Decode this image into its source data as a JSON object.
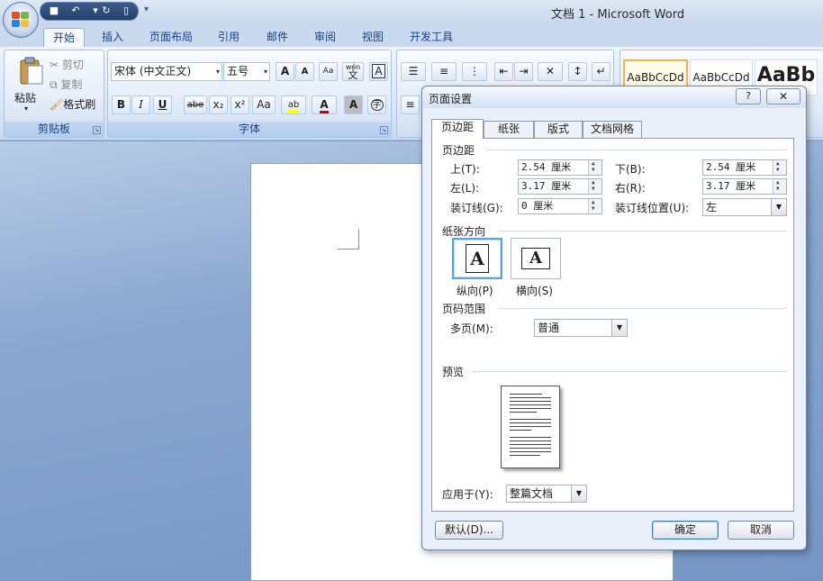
{
  "window": {
    "title": "文档 1 - Microsoft Word"
  },
  "ribbon_tabs": [
    "开始",
    "插入",
    "页面布局",
    "引用",
    "邮件",
    "审阅",
    "视图",
    "开发工具"
  ],
  "clipboard": {
    "paste": "粘贴",
    "cut": "剪切",
    "copy": "复制",
    "format_painter": "格式刷",
    "group_label": "剪贴板"
  },
  "font": {
    "name": "宋体 (中文正文)",
    "size": "五号",
    "group_label": "字体",
    "grow": "A",
    "shrink": "A",
    "bold": "B",
    "italic": "I",
    "underline": "U",
    "strike": "abe",
    "subscript": "x₂",
    "superscript": "x²",
    "case": "Aa",
    "highlight": "ab",
    "color": "A",
    "char_shading": "A",
    "enclose": "字",
    "phonetic": "wén",
    "phonetic_char": "文",
    "border": "A"
  },
  "styles": [
    {
      "label": "AaBbCcDd"
    },
    {
      "label": "AaBbCcDd"
    },
    {
      "label": "AaBb"
    }
  ],
  "dialog": {
    "title": "页面设置",
    "help": "?",
    "close": "✕",
    "tabs": [
      "页边距",
      "纸张",
      "版式",
      "文档网格"
    ],
    "margins_section": "页边距",
    "top_label": "上(T):",
    "top_value": "2.54 厘米",
    "bottom_label": "下(B):",
    "bottom_value": "2.54 厘米",
    "left_label": "左(L):",
    "left_value": "3.17 厘米",
    "right_label": "右(R):",
    "right_value": "3.17 厘米",
    "gutter_label": "装订线(G):",
    "gutter_value": "0 厘米",
    "gutter_pos_label": "装订线位置(U):",
    "gutter_pos_value": "左",
    "orientation_section": "纸张方向",
    "portrait": "纵向(P)",
    "landscape": "横向(S)",
    "orientation_glyph": "A",
    "pages_section": "页码范围",
    "multiple_pages_label": "多页(M):",
    "multiple_pages_value": "普通",
    "preview_section": "预览",
    "apply_to_label": "应用于(Y):",
    "apply_to_value": "整篇文档",
    "default_button": "默认(D)...",
    "ok_button": "确定",
    "cancel_button": "取消"
  }
}
